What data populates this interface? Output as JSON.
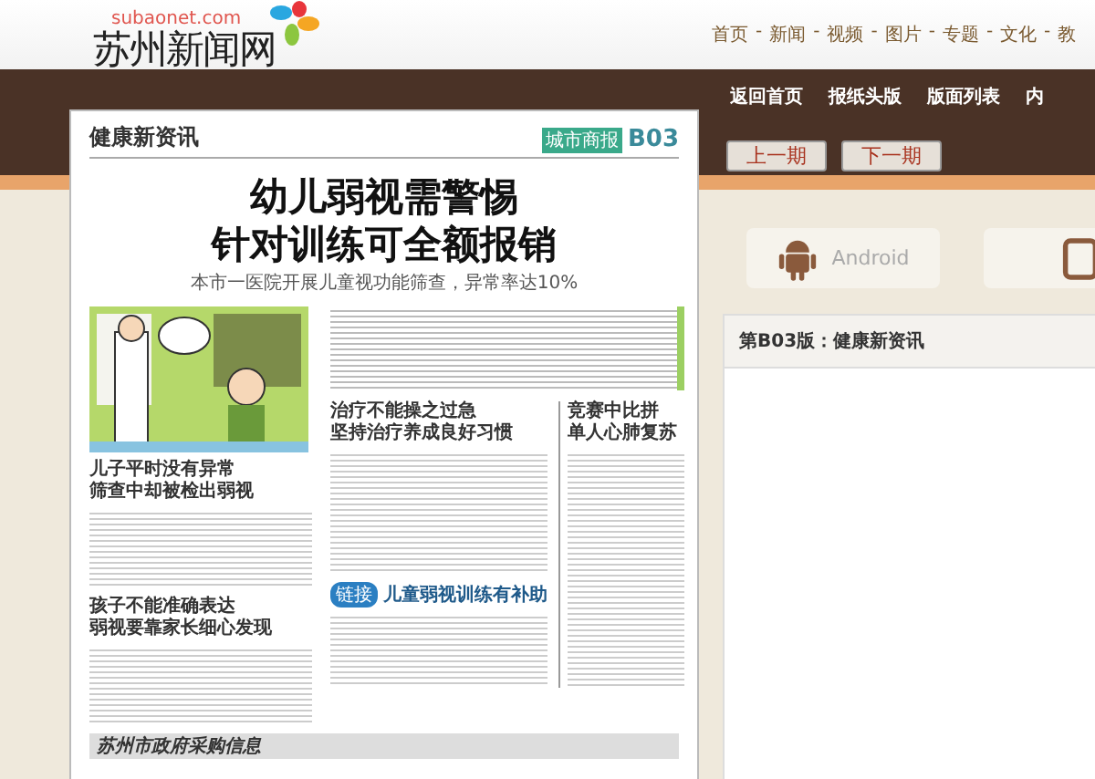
{
  "header": {
    "logo": {
      "domain": "subaonet.com",
      "name": "苏州新闻网"
    },
    "nav": [
      "首页",
      "新闻",
      "视频",
      "图片",
      "专题",
      "文化",
      "教"
    ],
    "separator": "-"
  },
  "subnav": [
    "返回首页",
    "报纸头版",
    "版面列表",
    "内"
  ],
  "issue_buttons": [
    "上一期",
    "下一期"
  ],
  "apps": [
    {
      "kind": "android",
      "label": "Android"
    },
    {
      "kind": "tablet"
    }
  ],
  "edition_panel": {
    "title": "第B03版：健康新资讯"
  },
  "newspaper": {
    "section": "健康新资讯",
    "masthead": "城市商报",
    "page": "B03",
    "headline": [
      "幼儿弱视需警惕",
      "针对训练可全额报销"
    ],
    "subhead": "本市一医院开展儿童视功能筛查，异常率达10%",
    "left_articles": [
      {
        "title": [
          "儿子平时没有异常",
          "筛查中却被检出弱视"
        ]
      },
      {
        "title": [
          "孩子不能准确表达",
          "弱视要靠家长细心发现"
        ]
      }
    ],
    "center_article": {
      "title": [
        "治疗不能操之过急",
        "坚持治疗养成良好习惯"
      ]
    },
    "side_article": {
      "title": [
        "竞赛中比拼",
        "单人心肺复苏"
      ]
    },
    "link_article": {
      "tag": "链接",
      "title": "儿童弱视训练有补助"
    },
    "banner": "苏州市政府采购信息"
  }
}
